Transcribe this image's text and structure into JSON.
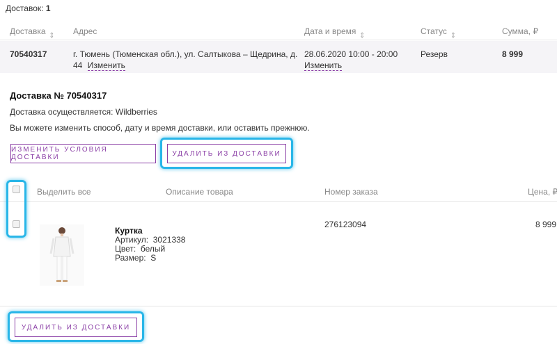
{
  "summary": {
    "label": "Доставок:",
    "count": "1"
  },
  "table": {
    "headers": {
      "delivery": "Доставка",
      "address": "Адрес",
      "datetime": "Дата и время",
      "status": "Статус",
      "sum": "Сумма, ₽"
    },
    "row": {
      "id": "70540317",
      "address_line1": "г. Тюмень (Тюменская обл.), ул. Салтыкова – Щедрина, д.",
      "address_line2": "44",
      "change_address": "Изменить",
      "datetime": "28.06.2020 10:00 - 20:00",
      "change_datetime": "Изменить",
      "status": "Резерв",
      "sum": "8 999"
    }
  },
  "detail": {
    "title": "Доставка № 70540317",
    "by": "Доставка осуществляется: Wildberries",
    "note": "Вы можете изменить способ, дату и время доставки, или оставить прежнюю.",
    "change_button": "Изменить условия доставки",
    "remove_button": "Удалить из доставки"
  },
  "items": {
    "headers": {
      "select_all": "Выделить все",
      "description": "Описание товара",
      "order_no": "Номер заказа",
      "price": "Цена, ₽"
    },
    "list": [
      {
        "name": "Куртка",
        "article_label": "Артикул:",
        "article": "3021338",
        "color_label": "Цвет:",
        "color": "белый",
        "size_label": "Размер:",
        "size": "S",
        "order_no": "276123094",
        "price": "8 999"
      }
    ],
    "remove_button": "Удалить из доставки"
  },
  "colors": {
    "accent": "#8b3fa6",
    "highlight": "#29b6e8",
    "band": "#f5f4f7"
  }
}
